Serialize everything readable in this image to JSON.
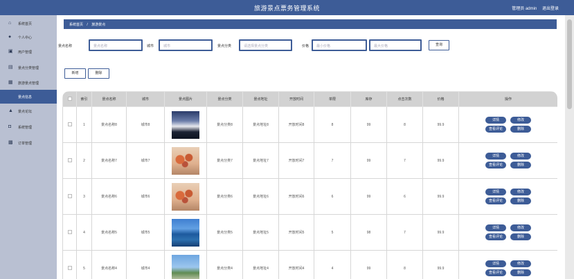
{
  "app": {
    "title": "旅游景点票务管理系统",
    "admin_label": "管理员 admin",
    "logout_label": "退出登录"
  },
  "sidebar": {
    "items": [
      {
        "label": "系统首页",
        "icon": "home-icon"
      },
      {
        "label": "个人中心",
        "icon": "person-icon"
      },
      {
        "label": "用户管理",
        "icon": "user-manage-icon"
      },
      {
        "label": "景点分类管理",
        "icon": "category-icon"
      },
      {
        "label": "旅游景点管理",
        "icon": "scenic-icon"
      },
      {
        "label": "景点信息",
        "icon": "info-icon"
      },
      {
        "label": "景点论坛",
        "icon": "forum-icon"
      },
      {
        "label": "系统管理",
        "icon": "system-icon"
      },
      {
        "label": "订单管理",
        "icon": "order-icon"
      }
    ]
  },
  "breadcrumb": {
    "home": "系统首页",
    "separator": "/",
    "current": "旅游景点"
  },
  "search": {
    "name_label": "景点名称",
    "name_placeholder": "景点名称",
    "city_label": "城市",
    "city_placeholder": "城市",
    "category_label": "景点分类",
    "category_placeholder": "请选择景点分类",
    "price_label": "价格",
    "price_min_placeholder": "最小价格",
    "price_max_placeholder": "最大价格",
    "query_button": "查询"
  },
  "toolbar": {
    "add_label": "新增",
    "delete_label": "删除"
  },
  "table": {
    "headers": [
      "索引",
      "景点名称",
      "城市",
      "景点图片",
      "景点分类",
      "景点地址",
      "开放时间",
      "单限",
      "库存",
      "点击次数",
      "价格",
      "操作"
    ],
    "actions": [
      "详情",
      "修改",
      "查看评论",
      "删除"
    ],
    "rows": [
      {
        "index": "1",
        "name": "景点名称8",
        "city": "城市8",
        "image": "img-a",
        "category": "景点分类8",
        "address": "景点地址8",
        "open": "开放时间8",
        "limit": "8",
        "stock": "99",
        "clicks": "8",
        "price": "99.9"
      },
      {
        "index": "2",
        "name": "景点名称7",
        "city": "城市7",
        "image": "img-b",
        "category": "景点分类7",
        "address": "景点地址7",
        "open": "开放时间7",
        "limit": "7",
        "stock": "99",
        "clicks": "7",
        "price": "99.9"
      },
      {
        "index": "3",
        "name": "景点名称6",
        "city": "城市6",
        "image": "img-b",
        "category": "景点分类6",
        "address": "景点地址6",
        "open": "开放时间6",
        "limit": "6",
        "stock": "99",
        "clicks": "6",
        "price": "99.9"
      },
      {
        "index": "4",
        "name": "景点名称5",
        "city": "城市5",
        "image": "img-c",
        "category": "景点分类5",
        "address": "景点地址5",
        "open": "开放时间5",
        "limit": "5",
        "stock": "98",
        "clicks": "7",
        "price": "99.9"
      },
      {
        "index": "5",
        "name": "景点名称4",
        "city": "城市4",
        "image": "img-d",
        "category": "景点分类4",
        "address": "景点地址4",
        "open": "开放时间4",
        "limit": "4",
        "stock": "99",
        "clicks": "8",
        "price": "99.9"
      }
    ]
  },
  "colors": {
    "primary": "#3d5c97",
    "sidebar_bg": "#b9c0d2",
    "header_row": "#d2d2d2"
  }
}
